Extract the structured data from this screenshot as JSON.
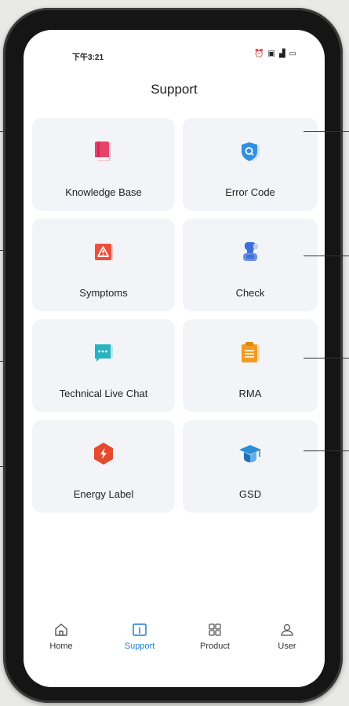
{
  "status_bar": {
    "time": "下午3:21",
    "icons": [
      "alarm-icon",
      "battery-saver-icon",
      "signal-icon",
      "battery-icon"
    ]
  },
  "header": {
    "title": "Support"
  },
  "cards": [
    {
      "label": "Knowledge Base",
      "icon": "book-icon",
      "color": "#e8426b"
    },
    {
      "label": "Error Code",
      "icon": "shield-search-icon",
      "color": "#2f8fe0"
    },
    {
      "label": "Symptoms",
      "icon": "warning-icon",
      "color": "#ee4f3c"
    },
    {
      "label": "Check",
      "icon": "check-robot-icon",
      "color": "#3d6fd8"
    },
    {
      "label": "Technical Live Chat",
      "icon": "chat-icon",
      "color": "#27b3c2"
    },
    {
      "label": "RMA",
      "icon": "clipboard-icon",
      "color": "#f39a20"
    },
    {
      "label": "Energy Label",
      "icon": "energy-hexagon-icon",
      "color": "#e64a2e"
    },
    {
      "label": "GSD",
      "icon": "graduation-cap-icon",
      "color": "#2a8fd8"
    }
  ],
  "tabbar": {
    "items": [
      {
        "label": "Home",
        "icon": "home-icon"
      },
      {
        "label": "Support",
        "icon": "support-icon",
        "active": true,
        "color": "#1b7fd6"
      },
      {
        "label": "Product",
        "icon": "grid-icon"
      },
      {
        "label": "User",
        "icon": "user-icon"
      }
    ]
  }
}
